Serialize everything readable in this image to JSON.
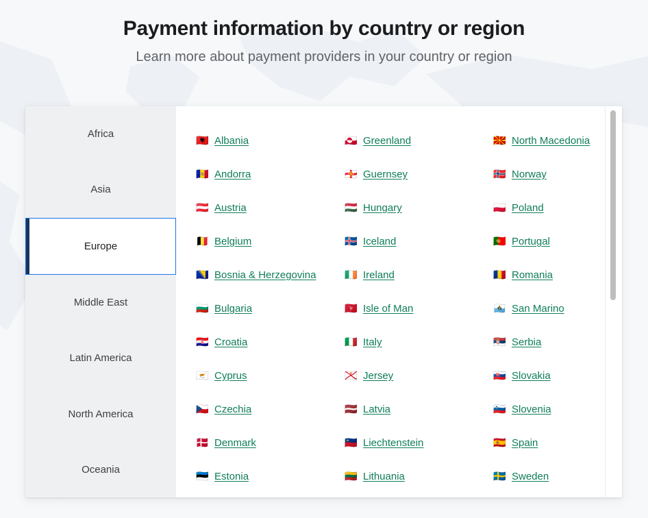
{
  "hero": {
    "title": "Payment information by country or region",
    "subtitle": "Learn more about payment providers in your country or region"
  },
  "colors": {
    "page_background": "#f7f8fa",
    "card_background": "#ffffff",
    "sidebar_background": "#eff0f2",
    "active_tab_border": "#1a73e8",
    "active_tab_accent": "#17365d",
    "link": "#0e7d57",
    "title_text": "#1a1c1e",
    "subtitle_text": "#5f6368",
    "scrollbar_thumb": "#bdbdbd"
  },
  "region_tabs": {
    "selected": "Europe",
    "items": [
      {
        "label": "Africa",
        "active": false
      },
      {
        "label": "Asia",
        "active": false
      },
      {
        "label": "Europe",
        "active": true
      },
      {
        "label": "Middle East",
        "active": false
      },
      {
        "label": "Latin America",
        "active": false
      },
      {
        "label": "North America",
        "active": false
      },
      {
        "label": "Oceania",
        "active": false
      }
    ]
  },
  "countries": {
    "columns": [
      [
        {
          "flag": "🇦🇱",
          "flag_name": "flag-albania",
          "name": "Albania"
        },
        {
          "flag": "🇦🇩",
          "flag_name": "flag-andorra",
          "name": "Andorra"
        },
        {
          "flag": "🇦🇹",
          "flag_name": "flag-austria",
          "name": "Austria"
        },
        {
          "flag": "🇧🇪",
          "flag_name": "flag-belgium",
          "name": "Belgium"
        },
        {
          "flag": "🇧🇦",
          "flag_name": "flag-bosnia-and-herzegovina",
          "name": "Bosnia & Herzegovina"
        },
        {
          "flag": "🇧🇬",
          "flag_name": "flag-bulgaria",
          "name": "Bulgaria"
        },
        {
          "flag": "🇭🇷",
          "flag_name": "flag-croatia",
          "name": "Croatia"
        },
        {
          "flag": "🇨🇾",
          "flag_name": "flag-cyprus",
          "name": "Cyprus"
        },
        {
          "flag": "🇨🇿",
          "flag_name": "flag-czechia",
          "name": "Czechia"
        },
        {
          "flag": "🇩🇰",
          "flag_name": "flag-denmark",
          "name": "Denmark"
        },
        {
          "flag": "🇪🇪",
          "flag_name": "flag-estonia",
          "name": "Estonia"
        }
      ],
      [
        {
          "flag": "🇬🇱",
          "flag_name": "flag-greenland",
          "name": "Greenland"
        },
        {
          "flag": "🇬🇬",
          "flag_name": "flag-guernsey",
          "name": "Guernsey"
        },
        {
          "flag": "🇭🇺",
          "flag_name": "flag-hungary",
          "name": "Hungary"
        },
        {
          "flag": "🇮🇸",
          "flag_name": "flag-iceland",
          "name": "Iceland"
        },
        {
          "flag": "🇮🇪",
          "flag_name": "flag-ireland",
          "name": "Ireland"
        },
        {
          "flag": "🇮🇲",
          "flag_name": "flag-isle-of-man",
          "name": "Isle of Man"
        },
        {
          "flag": "🇮🇹",
          "flag_name": "flag-italy",
          "name": "Italy"
        },
        {
          "flag": "🇯🇪",
          "flag_name": "flag-jersey",
          "name": "Jersey"
        },
        {
          "flag": "🇱🇻",
          "flag_name": "flag-latvia",
          "name": "Latvia"
        },
        {
          "flag": "🇱🇮",
          "flag_name": "flag-liechtenstein",
          "name": "Liechtenstein"
        },
        {
          "flag": "🇱🇹",
          "flag_name": "flag-lithuania",
          "name": "Lithuania"
        }
      ],
      [
        {
          "flag": "🇲🇰",
          "flag_name": "flag-north-macedonia",
          "name": "North Macedonia"
        },
        {
          "flag": "🇳🇴",
          "flag_name": "flag-norway",
          "name": "Norway"
        },
        {
          "flag": "🇵🇱",
          "flag_name": "flag-poland",
          "name": "Poland"
        },
        {
          "flag": "🇵🇹",
          "flag_name": "flag-portugal",
          "name": "Portugal"
        },
        {
          "flag": "🇷🇴",
          "flag_name": "flag-romania",
          "name": "Romania"
        },
        {
          "flag": "🇸🇲",
          "flag_name": "flag-san-marino",
          "name": "San Marino"
        },
        {
          "flag": "🇷🇸",
          "flag_name": "flag-serbia",
          "name": "Serbia"
        },
        {
          "flag": "🇸🇰",
          "flag_name": "flag-slovakia",
          "name": "Slovakia"
        },
        {
          "flag": "🇸🇮",
          "flag_name": "flag-slovenia",
          "name": "Slovenia"
        },
        {
          "flag": "🇪🇸",
          "flag_name": "flag-spain",
          "name": "Spain"
        },
        {
          "flag": "🇸🇪",
          "flag_name": "flag-sweden",
          "name": "Sweden"
        }
      ]
    ]
  }
}
